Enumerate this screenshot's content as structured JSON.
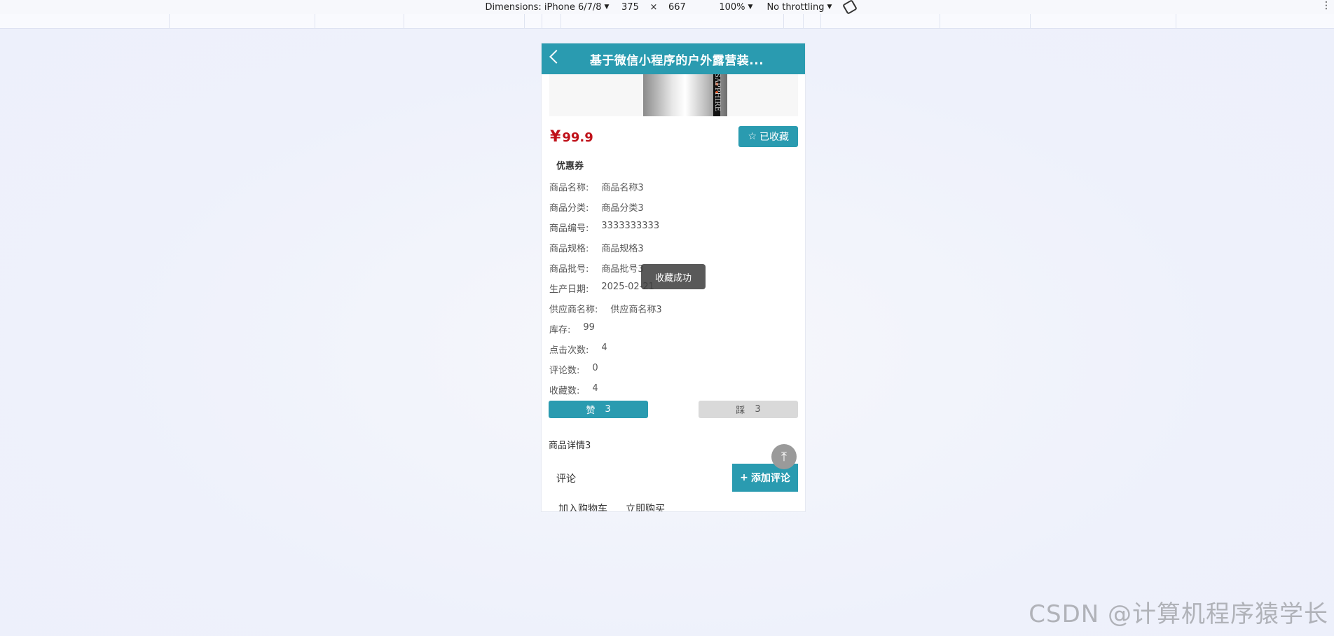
{
  "devtools": {
    "dimensions_label": "Dimensions: iPhone 6/7/8",
    "width": "375",
    "x": "×",
    "height": "667",
    "zoom": "100%",
    "throttling": "No throttling"
  },
  "app": {
    "nav_title": "基于微信小程序的户外露营装...",
    "image_text": "SAPPHIRE",
    "price_symbol": "¥",
    "price": "99.9",
    "fav_icon": "☆",
    "fav_label": "已收藏",
    "coupon_label": "优惠券",
    "info": [
      {
        "k": "商品名称:",
        "v": "商品名称3"
      },
      {
        "k": "商品分类:",
        "v": "商品分类3"
      },
      {
        "k": "商品编号:",
        "v": "3333333333"
      },
      {
        "k": "商品规格:",
        "v": "商品规格3"
      },
      {
        "k": "商品批号:",
        "v": "商品批号3"
      },
      {
        "k": "生产日期:",
        "v": "2025-02-21"
      },
      {
        "k": "供应商名称:",
        "v": "供应商名称3"
      },
      {
        "k": "库存:",
        "v": "99"
      },
      {
        "k": "点击次数:",
        "v": "4"
      },
      {
        "k": "评论数:",
        "v": "0"
      },
      {
        "k": "收藏数:",
        "v": "4"
      }
    ],
    "vote_up_label": "赞",
    "vote_up_count": "3",
    "vote_down_label": "踩",
    "vote_down_count": "3",
    "detail_text": "商品详情3",
    "comment_label": "评论",
    "add_comment_icon": "+",
    "add_comment_label": "添加评论",
    "cart_label": "加入购物车",
    "buy_label": "立即购买",
    "toast_text": "收藏成功",
    "to_top_icon": "⤒"
  },
  "watermark": "CSDN @计算机程序猿学长",
  "colors": {
    "primary": "#2a9bb0",
    "price": "#c0121a"
  }
}
